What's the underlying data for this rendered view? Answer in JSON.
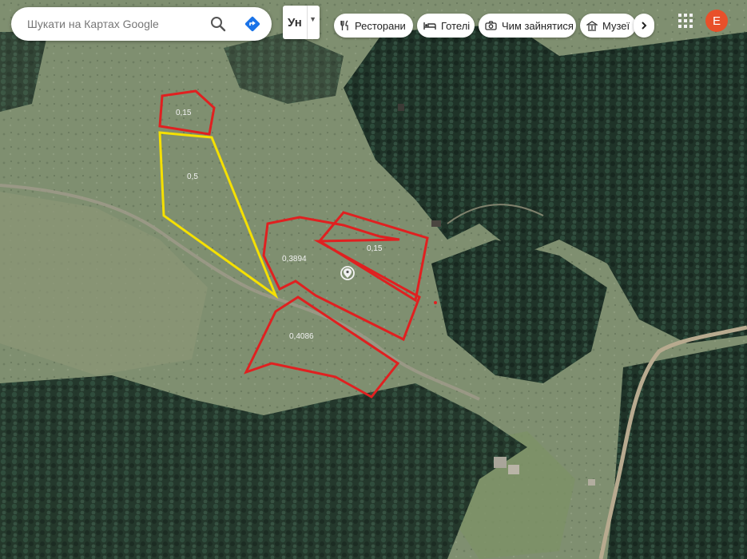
{
  "search": {
    "placeholder": "Шукати на Картах Google"
  },
  "icons": {
    "search": "search-icon",
    "directions": "directions-icon",
    "apps": "apps-grid-icon",
    "restaurants": "fork-knife-icon",
    "hotels": "bed-icon",
    "things_to_do": "camera-icon",
    "museums": "museum-icon",
    "next": "chevron-right-icon",
    "pin": "place-pin-icon"
  },
  "layer_button": {
    "label": "Ун"
  },
  "chips": [
    {
      "label": "Ресторани"
    },
    {
      "label": "Готелі"
    },
    {
      "label": "Чим зайнятися"
    },
    {
      "label": "Музеї"
    }
  ],
  "account": {
    "initial": "E",
    "color": "#e8502a"
  },
  "parcels": [
    {
      "label": "0,15",
      "color": "#e02020"
    },
    {
      "label": "0,5",
      "color": "#f5e000"
    },
    {
      "label": "0,3894",
      "color": "#e02020"
    },
    {
      "label": "0,15",
      "color": "#e02020"
    },
    {
      "label": "0,4086",
      "color": "#e02020"
    }
  ]
}
